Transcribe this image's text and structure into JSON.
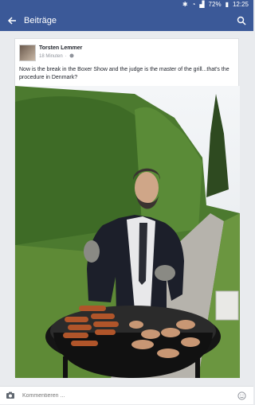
{
  "status_bar": {
    "battery": "72%",
    "time": "12:25"
  },
  "app_bar": {
    "title": "Beiträge"
  },
  "post": {
    "author": "Torsten Lemmer",
    "time": "18 Minuten",
    "text": "Now is the break in the Boxer Show and the judge is the master of the grill...that's the procedure in Denmark?"
  },
  "comment": {
    "placeholder": "Kommentieren ..."
  },
  "colors": {
    "brand": "#3b5998",
    "background": "#e9ebee"
  },
  "icons": [
    "back-arrow-icon",
    "search-icon",
    "camera-icon",
    "emoji-icon",
    "globe-icon"
  ]
}
